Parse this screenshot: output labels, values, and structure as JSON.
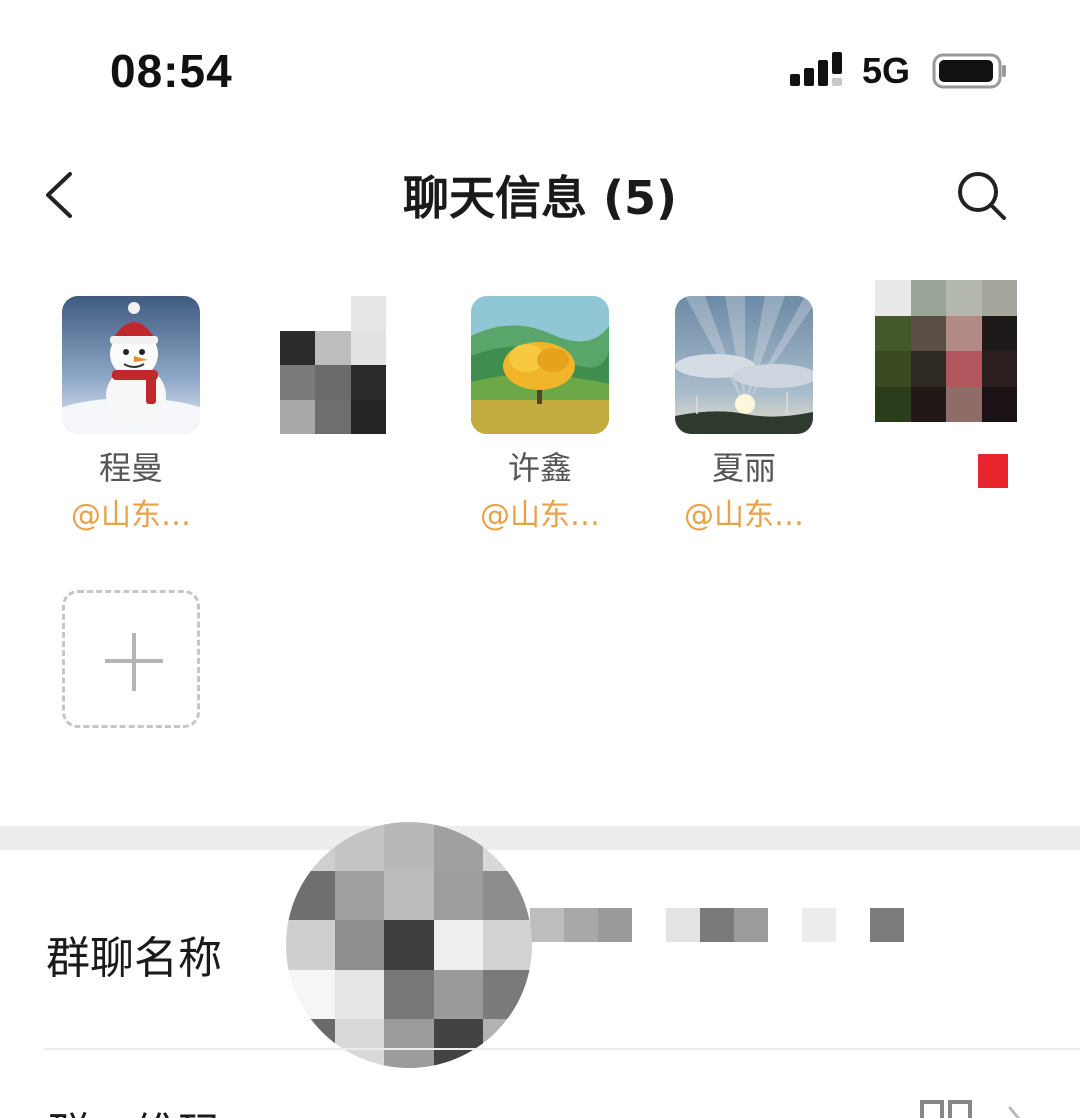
{
  "status_bar": {
    "time": "08:54",
    "network": "5G",
    "signal_icon": "signal-bars-icon",
    "battery_icon": "battery-icon"
  },
  "nav": {
    "back_icon": "chevron-left-icon",
    "title": "聊天信息 (5)",
    "search_icon": "search-icon"
  },
  "members": [
    {
      "name": "程曼",
      "tag": "@山东…",
      "avatar": "snowman-avatar"
    },
    {
      "name": "",
      "tag": "",
      "avatar": "mosaic-avatar"
    },
    {
      "name": "许鑫",
      "tag": "@山东…",
      "avatar": "tree-avatar"
    },
    {
      "name": "夏丽",
      "tag": "@山东…",
      "avatar": "sky-avatar"
    },
    {
      "name": "",
      "tag": "",
      "avatar": "mosaic-avatar"
    }
  ],
  "add_member_icon": "plus-icon",
  "settings": {
    "group_name_label": "群聊名称",
    "qr_label": "群二维码"
  },
  "colors": {
    "accent_tag": "#e8a24a",
    "divider_band": "#ededed"
  }
}
